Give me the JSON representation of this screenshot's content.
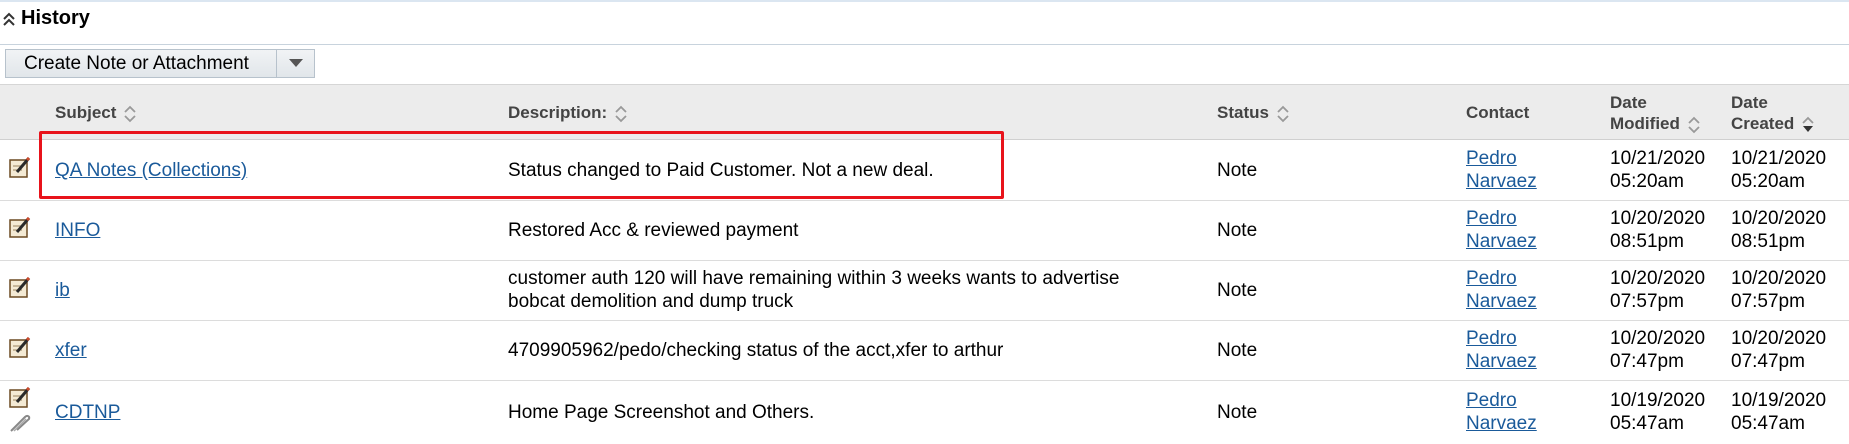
{
  "panel": {
    "title": "History"
  },
  "toolbar": {
    "create_label": "Create Note or Attachment"
  },
  "columns": {
    "subject": "Subject",
    "description": "Description:",
    "status": "Status",
    "contact": "Contact",
    "date_modified_1": "Date",
    "date_modified_2": "Modified",
    "date_created_1": "Date",
    "date_created_2": "Created"
  },
  "rows": [
    {
      "subject": "QA Notes (Collections)",
      "description": "Status changed to Paid Customer. Not a new deal.",
      "description2": "",
      "status": "Note",
      "contact_first": "Pedro",
      "contact_last": "Narvaez",
      "modified_date": "10/21/2020",
      "modified_time": "05:20am",
      "created_date": "10/21/2020",
      "created_time": "05:20am"
    },
    {
      "subject": "INFO",
      "description": "Restored Acc & reviewed payment",
      "description2": "",
      "status": "Note",
      "contact_first": "Pedro",
      "contact_last": "Narvaez",
      "modified_date": "10/20/2020",
      "modified_time": "08:51pm",
      "created_date": "10/20/2020",
      "created_time": "08:51pm"
    },
    {
      "subject": "ib",
      "description": "customer auth 120 will have remaining within 3 weeks wants to advertise",
      "description2": "bobcat demolition and dump truck",
      "status": "Note",
      "contact_first": "Pedro",
      "contact_last": "Narvaez",
      "modified_date": "10/20/2020",
      "modified_time": "07:57pm",
      "created_date": "10/20/2020",
      "created_time": "07:57pm"
    },
    {
      "subject": "xfer",
      "description": "4709905962/pedo/checking status of the acct,xfer to arthur",
      "description2": "",
      "status": "Note",
      "contact_first": "Pedro",
      "contact_last": "Narvaez",
      "modified_date": "10/20/2020",
      "modified_time": "07:47pm",
      "created_date": "10/20/2020",
      "created_time": "07:47pm"
    },
    {
      "subject": "CDTNP",
      "description": "Home Page Screenshot and Others.",
      "description2": "",
      "status": "Note",
      "contact_first": "Pedro",
      "contact_last": "Narvaez",
      "modified_date": "10/19/2020",
      "modified_time": "05:47am",
      "created_date": "10/19/2020",
      "created_time": "05:47am"
    }
  ]
}
